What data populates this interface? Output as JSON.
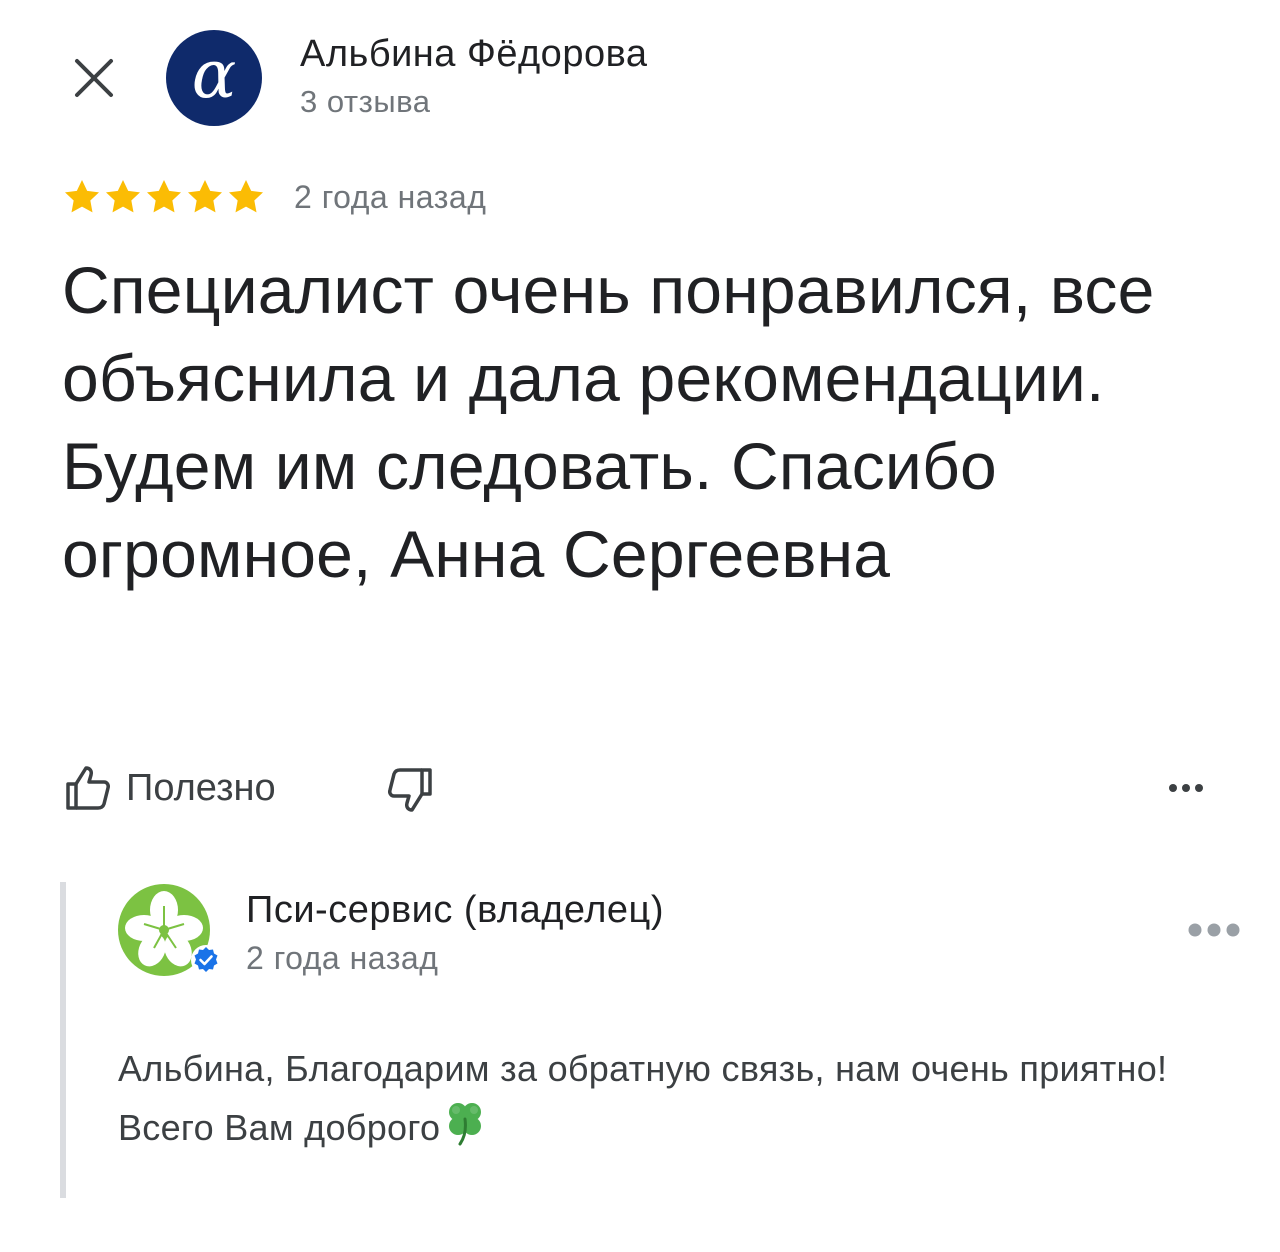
{
  "author": {
    "name": "Альбина Фёдорова",
    "meta": "3 отзыва",
    "avatar_letter": "α",
    "avatar_color": "#0f2a6b"
  },
  "review": {
    "rating": 5,
    "max_rating": 5,
    "date": "2 года назад",
    "text": "Специалист очень понравился, все объяснила и дала рекомендации. Будем им следовать. Спасибо огромное, Анна Сергеевна",
    "star_color": "#fbbc04"
  },
  "actions": {
    "helpful_label": "Полезно",
    "icons": [
      "thumb-up-icon",
      "thumb-down-icon",
      "more-horizontal-icon"
    ]
  },
  "owner_reply": {
    "name": "Пси-сервис (владелец)",
    "date": "2 года назад",
    "text": "Альбина, Благодарим за обратную связь, нам очень приятно! Всего Вам доброго",
    "trailing_emoji": "four-leaf-clover",
    "badge": "verified-icon",
    "badge_color": "#1a73e8",
    "logo_color": "#7cc242"
  }
}
